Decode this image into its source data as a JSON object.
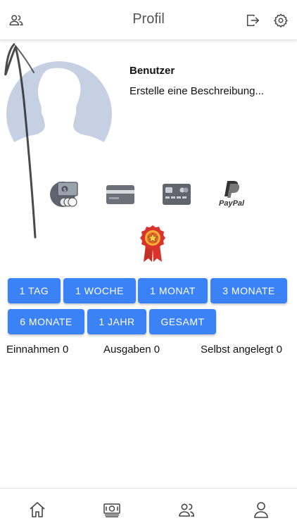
{
  "header": {
    "title": "Profil",
    "left_icon": "users-icon",
    "right_icons": [
      "logout-icon",
      "gear-icon"
    ]
  },
  "profile": {
    "avatar": "avatar-silhouette",
    "name": "Benutzer",
    "description": "Erstelle eine Beschreibung..."
  },
  "payment_methods": [
    {
      "icon": "cash-icon"
    },
    {
      "icon": "credit-card-icon"
    },
    {
      "icon": "debit-card-icon"
    },
    {
      "icon": "paypal-icon",
      "label": "PayPal"
    }
  ],
  "badge": {
    "icon": "award-badge-icon"
  },
  "period_buttons": [
    {
      "label": "1 TAG"
    },
    {
      "label": "1 WOCHE"
    },
    {
      "label": "1 MONAT"
    },
    {
      "label": "3 MONATE"
    },
    {
      "label": "6 MONATE"
    },
    {
      "label": "1 JAHR"
    },
    {
      "label": "GESAMT"
    }
  ],
  "stats": {
    "income": "Einnahmen 0",
    "expenses": "Ausgaben 0",
    "self_created": "Selbst angelegt 0"
  },
  "bottom_nav": [
    {
      "icon": "home-icon"
    },
    {
      "icon": "money-icon"
    },
    {
      "icon": "users-icon"
    },
    {
      "icon": "profile-icon"
    }
  ],
  "colors": {
    "accent": "#3b82f6",
    "avatar": "#c5d0e3",
    "badge_red": "#d9332b",
    "badge_gold": "#f2b233"
  }
}
